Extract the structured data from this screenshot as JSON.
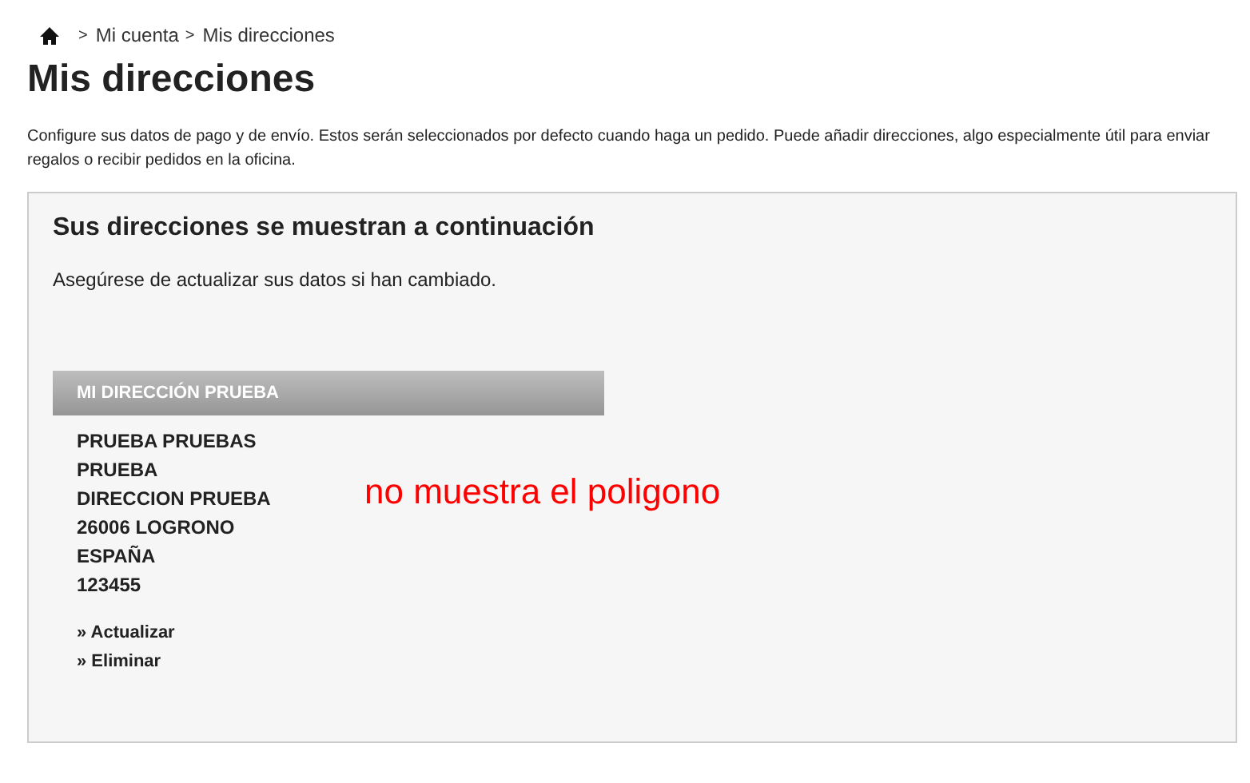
{
  "breadcrumb": {
    "separator_1": ">",
    "items": [
      "Mi cuenta",
      "Mis direcciones"
    ],
    "separator_2": ">"
  },
  "title": "Mis direcciones",
  "intro": "Configure sus datos de pago y de envío. Estos serán seleccionados por defecto cuando haga un pedido. Puede añadir direcciones, algo especialmente útil para enviar regalos o recibir pedidos en la oficina.",
  "panel": {
    "heading": "Sus direcciones se muestran a continuación",
    "subtext": "Asegúrese de actualizar sus datos si han cambiado.",
    "address": {
      "header": "MI DIRECCIÓN PRUEBA",
      "lines": [
        "PRUEBA PRUEBAS",
        "PRUEBA",
        "DIRECCION PRUEBA",
        "26006 LOGRONO",
        "ESPAÑA",
        "123455"
      ],
      "links": [
        "» Actualizar",
        "» Eliminar"
      ]
    },
    "annotation": "no muestra el poligono"
  }
}
